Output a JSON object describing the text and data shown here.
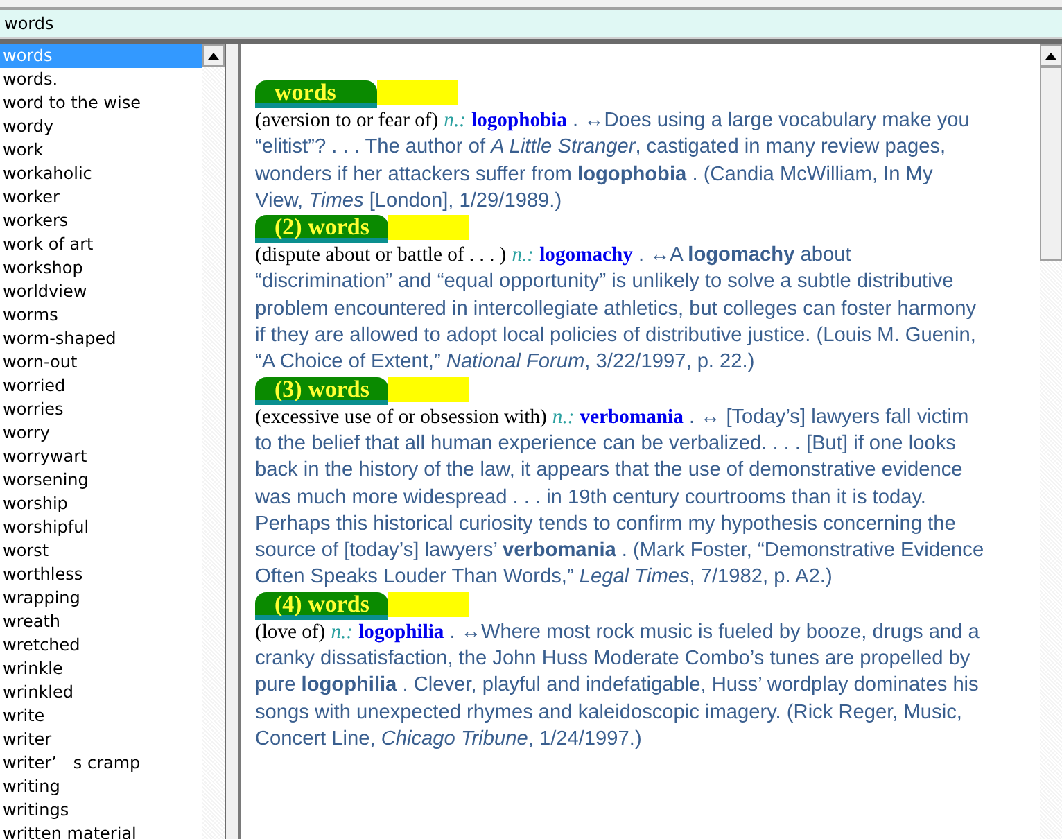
{
  "search": {
    "value": "words"
  },
  "word_list": [
    {
      "label": "words",
      "selected": true
    },
    {
      "label": "words.",
      "selected": false
    },
    {
      "label": "word to the wise",
      "selected": false
    },
    {
      "label": "wordy",
      "selected": false
    },
    {
      "label": "work",
      "selected": false
    },
    {
      "label": "workaholic",
      "selected": false
    },
    {
      "label": "worker",
      "selected": false
    },
    {
      "label": "workers",
      "selected": false
    },
    {
      "label": "work of art",
      "selected": false
    },
    {
      "label": "workshop",
      "selected": false
    },
    {
      "label": "worldview",
      "selected": false
    },
    {
      "label": "worms",
      "selected": false
    },
    {
      "label": "worm-shaped",
      "selected": false
    },
    {
      "label": "worn-out",
      "selected": false
    },
    {
      "label": "worried",
      "selected": false
    },
    {
      "label": "worries",
      "selected": false
    },
    {
      "label": "worry",
      "selected": false
    },
    {
      "label": "worrywart",
      "selected": false
    },
    {
      "label": "worsening",
      "selected": false
    },
    {
      "label": "worship",
      "selected": false
    },
    {
      "label": "worshipful",
      "selected": false
    },
    {
      "label": "worst",
      "selected": false
    },
    {
      "label": "worthless",
      "selected": false
    },
    {
      "label": "wrapping",
      "selected": false
    },
    {
      "label": "wreath",
      "selected": false
    },
    {
      "label": "wretched",
      "selected": false
    },
    {
      "label": "wrinkle",
      "selected": false
    },
    {
      "label": "wrinkled",
      "selected": false
    },
    {
      "label": "write",
      "selected": false
    },
    {
      "label": "writer",
      "selected": false
    },
    {
      "label": "writer’　s cramp",
      "selected": false
    },
    {
      "label": "writing",
      "selected": false
    },
    {
      "label": "writings",
      "selected": false
    },
    {
      "label": "written material",
      "selected": false
    }
  ],
  "entries": [
    {
      "headword": "words",
      "gloss": "(aversion to or fear of)",
      "pos": "n.:",
      "term": "logophobia",
      "quote": ". ↔Does using a large vocabulary make you “elitist”? . . . The author of *A Little Stranger*, castigated in many review pages, wonders if her attackers suffer from **logophobia** . (Candia McWilliam, In My View, *Times* [London], 1/29/1989.)"
    },
    {
      "headword": "(2) words",
      "gloss": "(dispute about or battle of . . . )",
      "pos": "n.:",
      "term": "logomachy",
      "quote": ". ↔A **logomachy** about “discrimination” and “equal opportunity” is unlikely to solve a subtle distributive problem encountered in intercollegiate athletics, but colleges can foster harmony if they are allowed to adopt local policies of distributive justice. (Louis M. Guenin, “A Choice of Extent,” *National Forum*, 3/22/1997, p. 22.)"
    },
    {
      "headword": "(3) words",
      "gloss": "(excessive use of or obsession with)",
      "pos": "n.:",
      "term": "verbomania",
      "quote": ". ↔ [Today’s] lawyers fall victim to the belief that all human experience can be verbalized. . . . [But] if one looks back in the history of the law, it appears that the use of demonstrative evidence was much more widespread . . . in 19th century courtrooms than it is today. Perhaps this historical curiosity tends to confirm my hypothesis concerning the source of [today’s] lawyers’ **verbomania** . (Mark Foster, “Demonstrative Evidence Often Speaks Louder Than Words,” *Legal Times*, 7/1982, p. A2.)"
    },
    {
      "headword": "(4) words",
      "gloss": "(love of)",
      "pos": "n.:",
      "term": "logophilia",
      "quote": ". ↔Where most rock music is fueled by booze, drugs and a cranky dissatisfaction, the John Huss Moderate Combo’s tunes are propelled by pure **logophilia** . Clever, playful and indefatigable, Huss’ wordplay dominates his songs with unexpected rhymes and kaleidoscopic imagery. (Rick Reger, Music, Concert Line, *Chicago Tribune*, 1/24/1997.)"
    }
  ]
}
